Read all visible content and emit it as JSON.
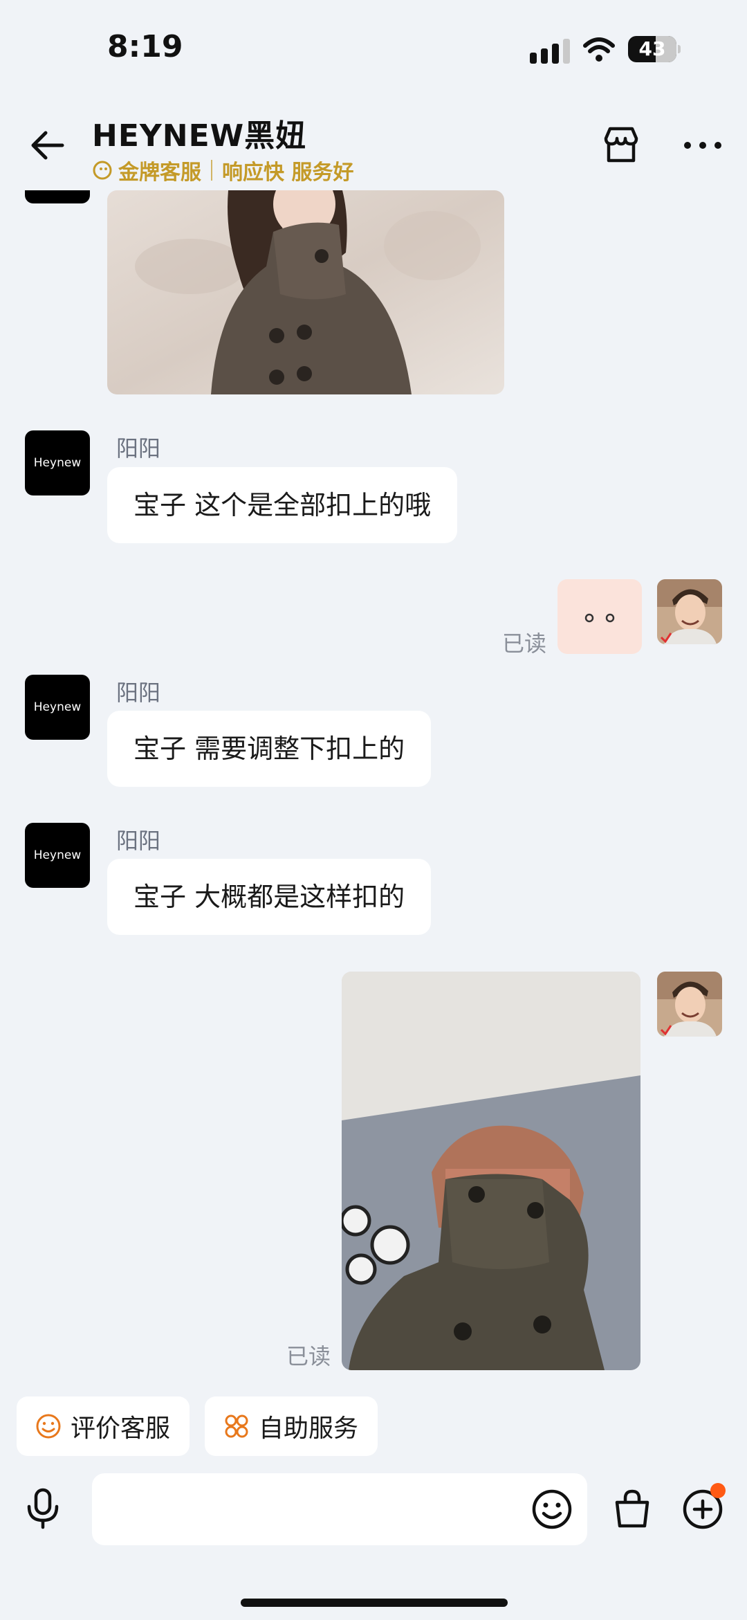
{
  "status_bar": {
    "time": "8:19",
    "battery_level": "43",
    "icons": [
      "signal-icon",
      "wifi-icon",
      "battery-icon"
    ]
  },
  "header": {
    "title": "HEYNEW黑妞",
    "badge": "金牌客服",
    "tagline": "响应快 服务好",
    "icons": [
      "back-arrow-icon",
      "store-icon",
      "more-icon"
    ],
    "accent_color": "#c49a28"
  },
  "shop_avatar_text": "Heynew",
  "messages": [
    {
      "from": "shop",
      "type": "image",
      "content": "coat-photo"
    },
    {
      "from": "shop",
      "sender": "阳阳",
      "type": "text",
      "text": "宝子 这个是全部扣上的哦"
    },
    {
      "from": "me",
      "type": "sticker",
      "status": "已读"
    },
    {
      "from": "shop",
      "sender": "阳阳",
      "type": "text",
      "text": "宝子 需要调整下扣上的"
    },
    {
      "from": "shop",
      "sender": "阳阳",
      "type": "text",
      "text": "宝子 大概都是这样扣的"
    },
    {
      "from": "me",
      "type": "image",
      "content": "selfie-coat-photo",
      "status": "已读"
    }
  ],
  "quick_actions": [
    {
      "label": "评价客服",
      "icon": "smiley-icon"
    },
    {
      "label": "自助服务",
      "icon": "grid-icon"
    }
  ],
  "input_bar": {
    "placeholder": "",
    "icons": [
      "mic-icon",
      "emoji-icon",
      "bag-icon",
      "plus-icon"
    ],
    "notification_color": "#ff5a14"
  }
}
